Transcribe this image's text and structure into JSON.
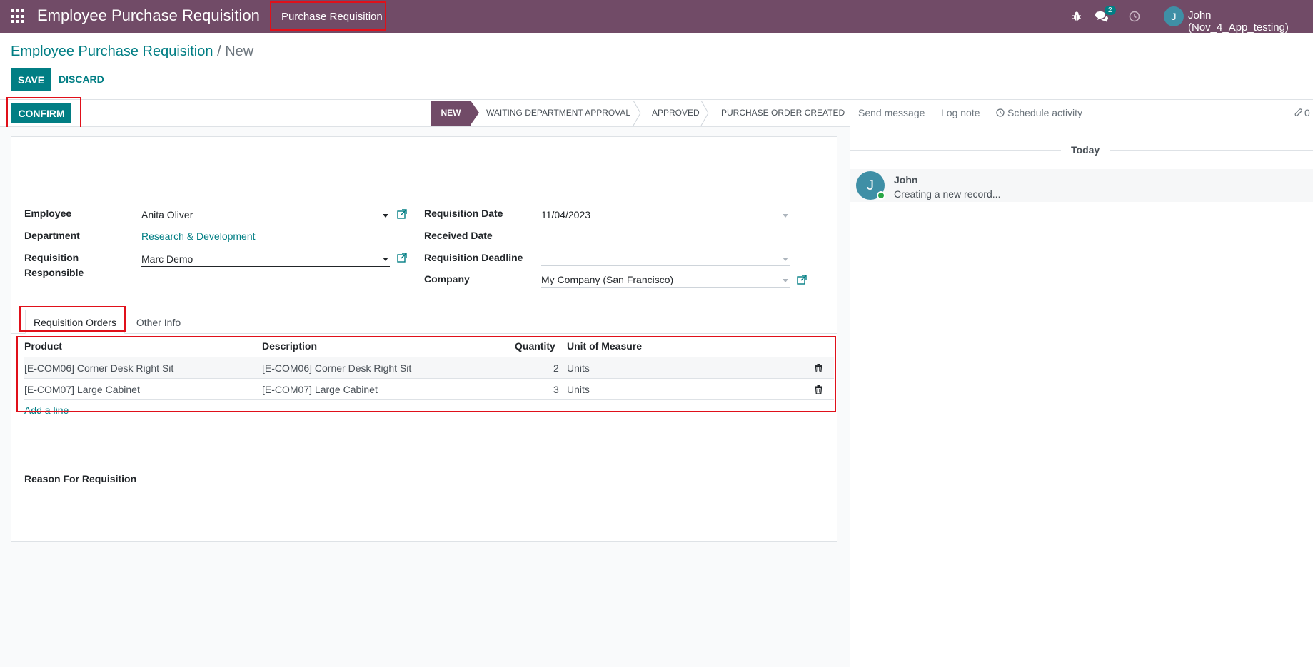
{
  "navbar": {
    "app_title": "Employee Purchase Requisition",
    "menu_item": "Purchase Requisition",
    "chat_badge": "2",
    "user_initial": "J",
    "user_name": "John (Nov_4_App_testing)"
  },
  "breadcrumb": {
    "parent": "Employee Purchase Requisition",
    "separator": "/",
    "current": "New"
  },
  "actions": {
    "save": "SAVE",
    "discard": "DISCARD",
    "confirm": "CONFIRM"
  },
  "stages": [
    "NEW",
    "WAITING DEPARTMENT APPROVAL",
    "APPROVED",
    "PURCHASE ORDER CREATED"
  ],
  "form": {
    "employee_label": "Employee",
    "employee_value": "Anita Oliver",
    "department_label": "Department",
    "department_value": "Research & Development",
    "responsible_label_1": "Requisition",
    "responsible_label_2": "Responsible",
    "responsible_value": "Marc Demo",
    "req_date_label": "Requisition Date",
    "req_date_value": "11/04/2023",
    "received_date_label": "Received Date",
    "deadline_label": "Requisition Deadline",
    "company_label": "Company",
    "company_value": "My Company (San Francisco)",
    "reason_label": "Reason For Requisition"
  },
  "tabs": {
    "orders": "Requisition Orders",
    "other": "Other Info"
  },
  "table": {
    "headers": {
      "product": "Product",
      "description": "Description",
      "quantity": "Quantity",
      "uom": "Unit of Measure"
    },
    "rows": [
      {
        "product": "[E-COM06] Corner Desk Right Sit",
        "description": "[E-COM06] Corner Desk Right Sit",
        "quantity": "2",
        "uom": "Units"
      },
      {
        "product": "[E-COM07] Large Cabinet",
        "description": "[E-COM07] Large Cabinet",
        "quantity": "3",
        "uom": "Units"
      }
    ],
    "add_line": "Add a line"
  },
  "chatter": {
    "send_message": "Send message",
    "log_note": "Log note",
    "schedule_activity": "Schedule activity",
    "attachments_count": "0",
    "today": "Today",
    "message_author": "John",
    "message_initial": "J",
    "message_body": "Creating a new record..."
  },
  "colors": {
    "brand": "#714b67",
    "accent": "#017e84",
    "highlight": "#e0101a"
  }
}
